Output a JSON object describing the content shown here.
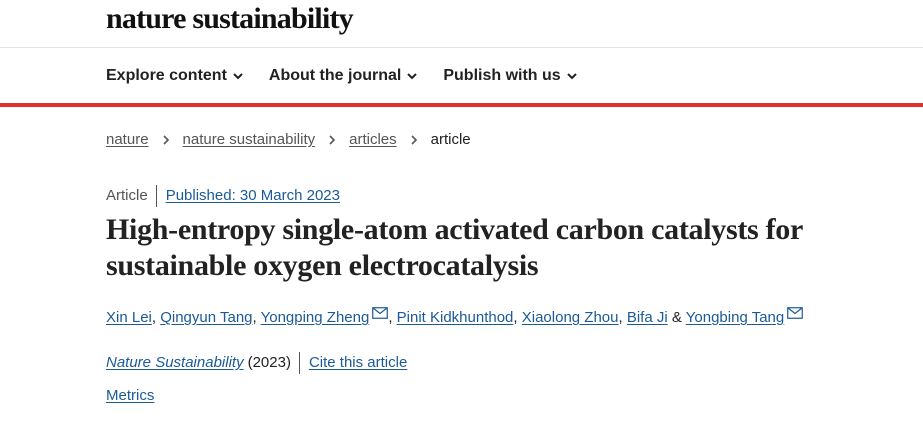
{
  "header": {
    "logo_text": "nature sustainability"
  },
  "nav": {
    "items": [
      {
        "label": "Explore content"
      },
      {
        "label": "About the journal"
      },
      {
        "label": "Publish with us"
      }
    ]
  },
  "breadcrumb": {
    "items": [
      "nature",
      "nature sustainability",
      "articles"
    ],
    "current": "article"
  },
  "article": {
    "type": "Article",
    "published": "Published: 30 March 2023",
    "title": "High-entropy single-atom activated carbon catalysts for sustainable oxygen electrocatalysis",
    "authors": [
      {
        "name": "Xin Lei",
        "sep": ", "
      },
      {
        "name": "Qingyun Tang",
        "sep": ", "
      },
      {
        "name": "Yongping Zheng",
        "sep": ", "
      },
      {
        "name": "Pinit Kidkhunthod",
        "sep": ", "
      },
      {
        "name": "Xiaolong Zhou",
        "sep": ", "
      },
      {
        "name": "Bifa Ji",
        "sep": " & "
      },
      {
        "name": "Yongbing Tang",
        "sep": ""
      }
    ],
    "journal": "Nature Sustainability",
    "year": "(2023)",
    "cite_label": "Cite this article",
    "metrics_label": "Metrics"
  },
  "colors": {
    "accent_red": "#e0312f",
    "link_blue": "#1b5a97"
  },
  "icons": {
    "nav_chevron": "chevron-down-icon",
    "crumb_separator": "chevron-right-icon",
    "email": "mail-icon"
  }
}
